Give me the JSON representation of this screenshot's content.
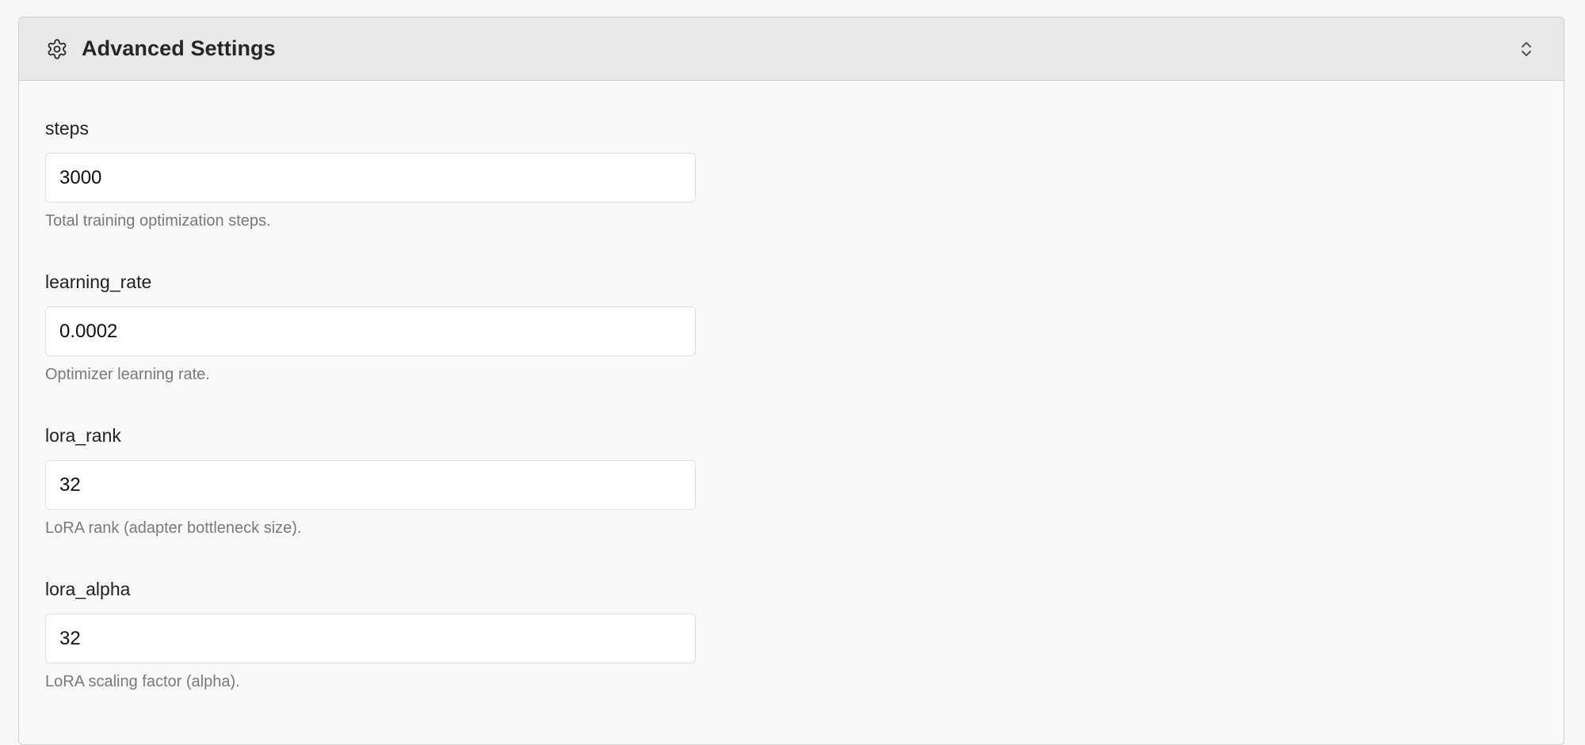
{
  "panel": {
    "title": "Advanced Settings",
    "icon": "gear-icon",
    "toggle_icon": "chevron-up-down-icon"
  },
  "fields": [
    {
      "label": "steps",
      "value": "3000",
      "help": "Total training optimization steps."
    },
    {
      "label": "learning_rate",
      "value": "0.0002",
      "help": "Optimizer learning rate."
    },
    {
      "label": "lora_rank",
      "value": "32",
      "help": "LoRA rank (adapter bottleneck size)."
    },
    {
      "label": "lora_alpha",
      "value": "32",
      "help": "LoRA scaling factor (alpha)."
    }
  ]
}
